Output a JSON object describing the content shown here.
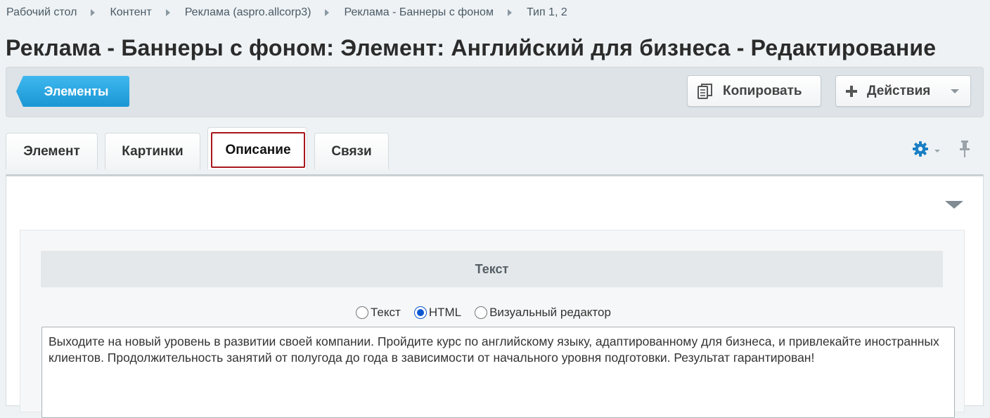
{
  "breadcrumb": [
    {
      "label": "Рабочий стол"
    },
    {
      "label": "Контент"
    },
    {
      "label": "Реклама (aspro.allcorp3)"
    },
    {
      "label": "Реклама - Баннеры с фоном"
    },
    {
      "label": "Тип 1, 2"
    }
  ],
  "page_title": "Реклама - Баннеры с фоном: Элемент: Английский для бизнеса - Редактирование",
  "toolbar": {
    "elements_label": "Элементы",
    "copy_label": "Копировать",
    "actions_label": "Действия"
  },
  "tabs": [
    {
      "label": "Элемент"
    },
    {
      "label": "Картинки"
    },
    {
      "label": "Описание",
      "active": true
    },
    {
      "label": "Связи"
    }
  ],
  "section": {
    "heading": "Текст",
    "modes": [
      {
        "label": "Текст",
        "checked": false
      },
      {
        "label": "HTML",
        "checked": true
      },
      {
        "label": "Визуальный редактор",
        "checked": false
      }
    ],
    "content": "Выходите на новый уровень в развитии своей компании. Пройдите курс по английскому языку, адаптированному для бизнеса, и привлекайте иностранных клиентов. Продолжительность занятий от полугода до года в зависимости от начального уровня подготовки. Результат гарантирован!"
  },
  "colors": {
    "accent": "#1a96d4",
    "active_tab_outline": "#a8171c",
    "gear": "#1a7fc4"
  },
  "icons": [
    "copy-icon",
    "plus-icon",
    "gear-icon",
    "pin-icon",
    "collapse-arrow-icon"
  ]
}
